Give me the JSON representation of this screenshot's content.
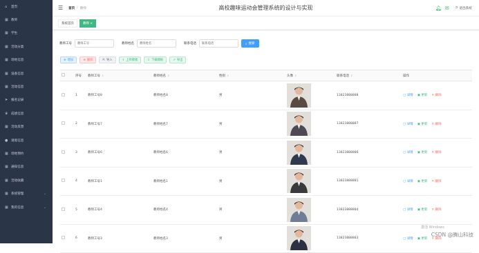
{
  "sidebar": {
    "items": [
      {
        "label": "首页",
        "icon": "home-icon",
        "glyph": "⌂"
      },
      {
        "label": "教师",
        "icon": "grid-icon",
        "glyph": "▦"
      },
      {
        "label": "学生",
        "icon": "grid-icon",
        "glyph": "▦"
      },
      {
        "label": "活动分类",
        "icon": "grid-icon",
        "glyph": "▦"
      },
      {
        "label": "场地信息",
        "icon": "grid-icon",
        "glyph": "▦"
      },
      {
        "label": "设备信息",
        "icon": "grid-icon",
        "glyph": "▦"
      },
      {
        "label": "活动信息",
        "icon": "grid-icon",
        "glyph": "▦"
      },
      {
        "label": "报名记录",
        "icon": "send-icon",
        "glyph": "➤"
      },
      {
        "label": "成绩信息",
        "icon": "trophy-icon",
        "glyph": "♛"
      },
      {
        "label": "活动反馈",
        "icon": "grid-icon",
        "glyph": "▦"
      },
      {
        "label": "请假信息",
        "icon": "location-icon",
        "glyph": "●"
      },
      {
        "label": "场地预约",
        "icon": "grid-icon",
        "glyph": "▦"
      },
      {
        "label": "通知信息",
        "icon": "grid-icon",
        "glyph": "▦"
      },
      {
        "label": "活动收藏",
        "icon": "grid-icon",
        "glyph": "▦"
      },
      {
        "label": "系统管理",
        "icon": "grid-icon",
        "glyph": "▦",
        "arrow": "⌄"
      },
      {
        "label": "我的信息",
        "icon": "grid-icon",
        "glyph": "▦",
        "arrow": "⌄"
      }
    ]
  },
  "header": {
    "menu_glyph": "☰",
    "breadcrumb": [
      "首页",
      "教师"
    ],
    "breadcrumb_sep": "/",
    "title": "高校趣味运动会管理系统的设计与实现",
    "logout": "退出系统"
  },
  "tabs": {
    "home": "系统首页",
    "current": "教师 ×"
  },
  "search": {
    "field1_label": "教师工号",
    "field1_placeholder": "教师工号",
    "field2_label": "教师姓名",
    "field2_placeholder": "教师姓名",
    "field3_label": "联系电话",
    "field3_placeholder": "联系电话",
    "button": "搜索"
  },
  "toolbar": {
    "add": "增加",
    "delete": "删除",
    "import": "导入",
    "upload": "上传模板",
    "download": "下载模板",
    "export": "导出"
  },
  "table": {
    "headers": [
      "",
      "序号",
      "教师工号",
      "教师姓名",
      "性别",
      "头像",
      "联系电话",
      "操作"
    ],
    "sort_glyph": "⇕",
    "ops": {
      "detail": "详情",
      "update": "更新",
      "delete": "删除"
    },
    "rows": [
      {
        "no": "1",
        "id": "教师工号8",
        "name": "教师姓名8",
        "gender": "男",
        "phone": "13823888888",
        "avatar_color": "#5a4a44"
      },
      {
        "no": "2",
        "id": "教师工号7",
        "name": "教师姓名7",
        "gender": "男",
        "phone": "13823888887",
        "avatar_color": "#4d4a55"
      },
      {
        "no": "3",
        "id": "教师工号6",
        "name": "教师姓名6",
        "gender": "男",
        "phone": "13823888886",
        "avatar_color": "#2f3a4d"
      },
      {
        "no": "4",
        "id": "教师工号1",
        "name": "教师姓名1",
        "gender": "男",
        "phone": "13823888881",
        "avatar_color": "#3a3a3d"
      },
      {
        "no": "5",
        "id": "教师工号4",
        "name": "教师姓名4",
        "gender": "男",
        "phone": "13823888884",
        "avatar_color": "#6f7e96"
      },
      {
        "no": "6",
        "id": "教师工号3",
        "name": "教师姓名3",
        "gender": "男",
        "phone": "13823888883",
        "avatar_color": "#2d3040"
      }
    ]
  },
  "watermark": {
    "line1": "激活 Windows",
    "line2": "CSDN @腾山科技"
  },
  "colors": {
    "sidebar_bg": "#2b3548",
    "accent_green": "#41b883",
    "accent_blue": "#409eff",
    "danger": "#f56c6c"
  }
}
